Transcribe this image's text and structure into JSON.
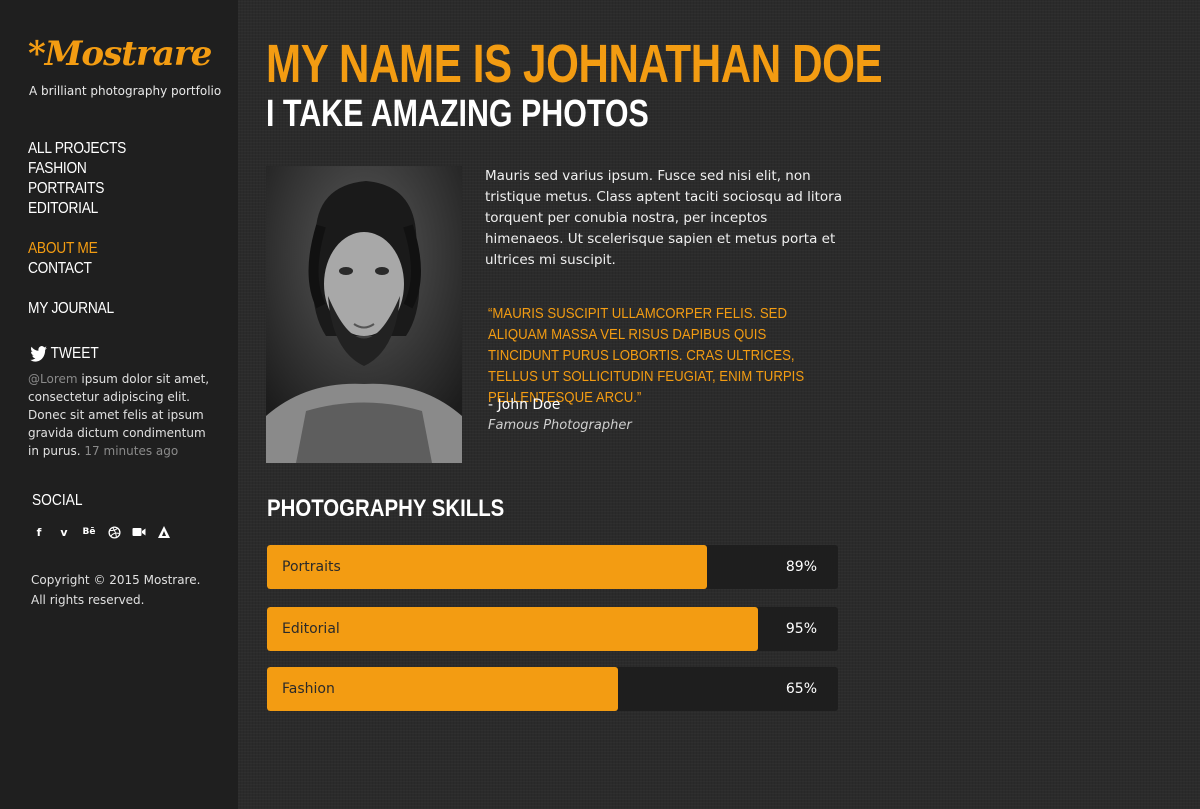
{
  "brand": {
    "logo": "*Mostrare",
    "tagline": "A brilliant photography portfolio"
  },
  "nav": {
    "group1": [
      "ALL PROJECTS",
      "FASHION",
      "PORTRAITS",
      "EDITORIAL"
    ],
    "group2": [
      "ABOUT ME",
      "CONTACT"
    ],
    "group3": [
      "MY JOURNAL"
    ],
    "active": "ABOUT ME"
  },
  "tweet": {
    "title": "TWEET",
    "handle": "@Lorem",
    "text": " ipsum dolor sit amet, consectetur adipiscing elit. Donec sit amet felis at ipsum gravida dictum condimentum in purus.",
    "time": "17 minutes ago"
  },
  "social": {
    "title": "SOCIAL",
    "icons": [
      "facebook-icon",
      "vimeo-icon",
      "behance-icon",
      "dribbble-icon",
      "video-icon",
      "vectr-icon"
    ]
  },
  "copyright": {
    "line1": "Copyright © 2015 Mostrare.",
    "line2": "All rights reserved."
  },
  "main": {
    "headline": "MY NAME IS JOHNATHAN DOE",
    "subheadline": "I TAKE AMAZING PHOTOS",
    "bio": "Mauris sed varius ipsum. Fusce sed nisi elit, non tristique metus. Class aptent taciti sociosqu ad litora torquent per conubia nostra, per inceptos himenaeos. Ut scelerisque sapien et metus porta et ultrices mi suscipit.",
    "quote": "“MAURIS SUSCIPIT ULLAMCORPER FELIS. SED ALIQUAM MASSA VEL RISUS DAPIBUS QUIS TINCIDUNT PURUS LOBORTIS. CRAS ULTRICES, TELLUS UT SOLLICITUDIN FEUGIAT, ENIM TURPIS PELLENTESQUE ARCU.”",
    "quote_author": "- John Doe",
    "quote_role": "Famous Photographer"
  },
  "skills": {
    "title": "PHOTOGRAPHY SKILLS",
    "items": [
      {
        "label": "Portraits",
        "percent": "89%",
        "value": 0.77
      },
      {
        "label": "Editorial",
        "percent": "95%",
        "value": 0.86
      },
      {
        "label": "Fashion",
        "percent": "65%",
        "value": 0.615
      }
    ]
  },
  "colors": {
    "accent": "#f39c12",
    "sidebar": "#1f1f1f",
    "background": "#2b2b2b"
  }
}
